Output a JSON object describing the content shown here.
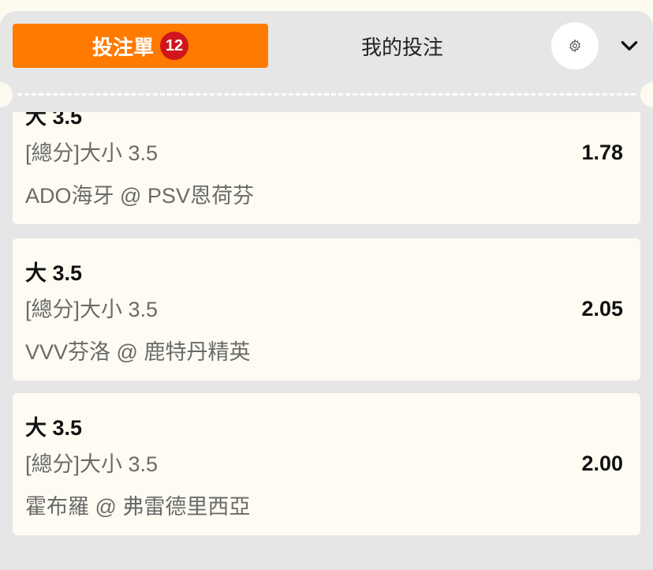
{
  "tabs": {
    "betslip_label": "投注單",
    "betslip_count": "12",
    "mybets_label": "我的投注"
  },
  "icons": {
    "settings": "gear-icon",
    "collapse": "chevron-down-icon"
  },
  "colors": {
    "accent": "#ff7a00",
    "badge": "#d0161c",
    "panel": "#e6e6e6",
    "card": "#fefcf2"
  },
  "bets": [
    {
      "selection": "大 3.5",
      "market": "[總分]大小 3.5",
      "match": "ADO海牙 @ PSV恩荷芬",
      "odds": "1.78"
    },
    {
      "selection": "大 3.5",
      "market": "[總分]大小 3.5",
      "match": "VVV芬洛 @ 鹿特丹精英",
      "odds": "2.05"
    },
    {
      "selection": "大 3.5",
      "market": "[總分]大小 3.5",
      "match": "霍布羅 @ 弗雷德里西亞",
      "odds": "2.00"
    }
  ]
}
